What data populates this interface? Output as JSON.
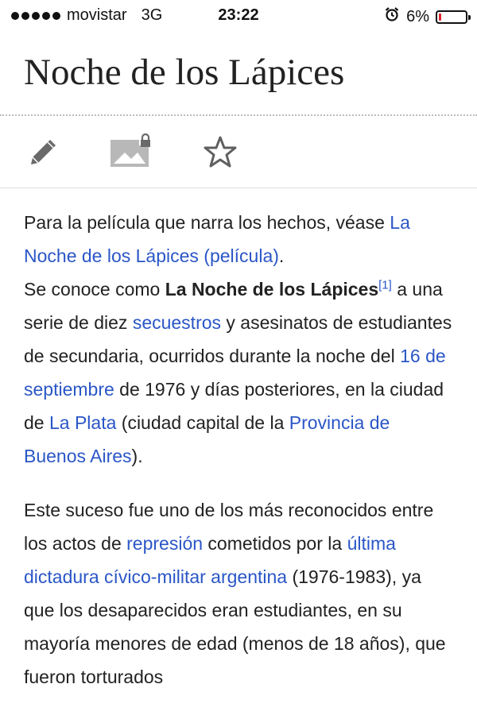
{
  "status_bar": {
    "carrier": "movistar",
    "network": "3G",
    "time": "23:22",
    "battery_percent": "6%",
    "battery_level": 0.06,
    "battery_color": "#e0232d"
  },
  "article": {
    "title": "Noche de los Lápices",
    "toolbar": {
      "icons": [
        "pencil-icon",
        "image-locked-icon",
        "star-icon"
      ]
    },
    "hatnote": {
      "text": "Para la película que narra los hechos, véase ",
      "link": "La Noche de los Lápices (película)",
      "end": "."
    },
    "p1": {
      "t1": "Se conoce como ",
      "bold": "La Noche de los Lápices",
      "ref": "[1]",
      "t2": " a una serie de diez ",
      "link_secuestros": "secuestros",
      "t3": " y asesinatos de estudiantes de secundaria, ocurridos durante la noche del ",
      "link_date": "16 de septiembre",
      "t4": " de 1976 y días posteriores, en la ciudad de ",
      "link_laplata": "La Plata",
      "t5": " (ciudad capital de la ",
      "link_provincia": "Provincia de Buenos Aires",
      "t6": ")."
    },
    "p2": {
      "t1": "Este suceso fue uno de los más reconocidos entre los actos de ",
      "link_represion": "represión",
      "t2": " cometidos por la ",
      "link_dictadura": "última dictadura cívico-militar argentina",
      "t3": " (1976-1983), ya que los desaparecidos eran estudiantes, en su mayoría menores de edad (menos de 18 años), que fueron torturados"
    },
    "link_color": "#2a56c6"
  }
}
